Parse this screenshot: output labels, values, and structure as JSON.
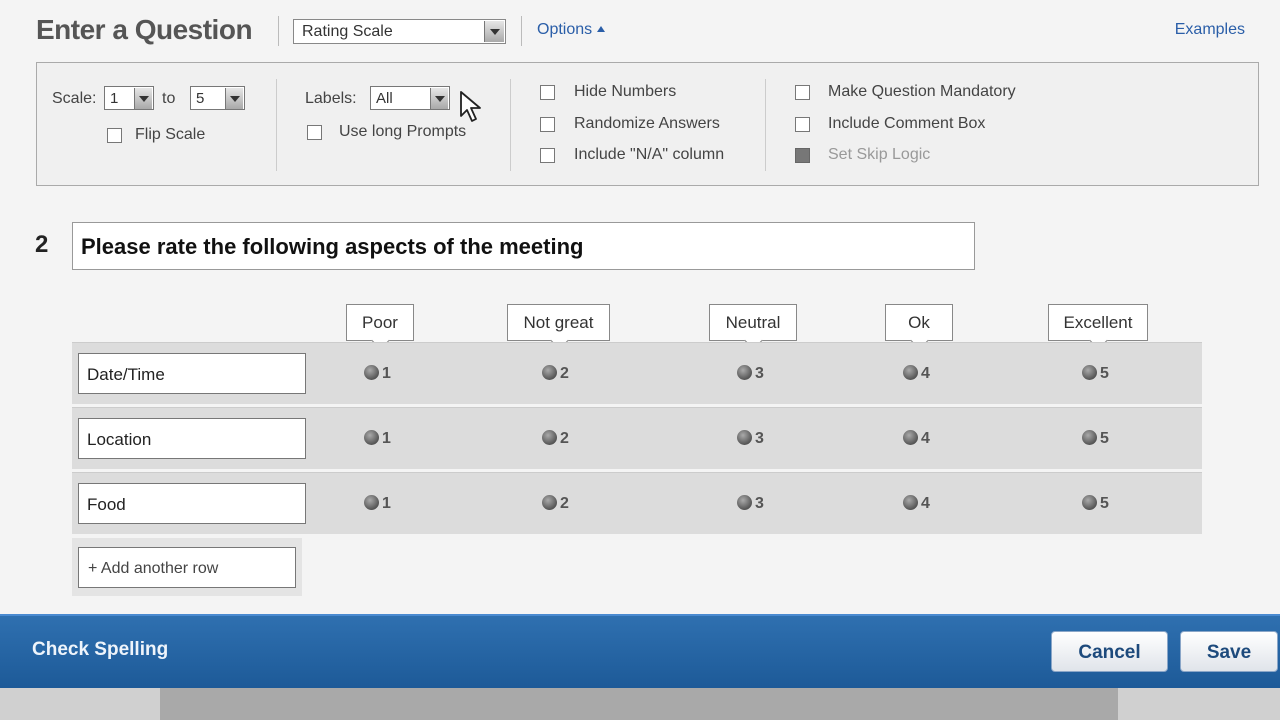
{
  "header": {
    "title": "Enter a Question",
    "question_type": "Rating Scale",
    "options_label": "Options",
    "examples_label": "Examples"
  },
  "options": {
    "scale_label": "Scale:",
    "scale_from": "1",
    "scale_to_label": "to",
    "scale_to": "5",
    "flip_scale": "Flip Scale",
    "labels_label": "Labels:",
    "labels_value": "All",
    "long_prompts": "Use long Prompts",
    "hide_numbers": "Hide Numbers",
    "randomize_answers": "Randomize Answers",
    "include_na": "Include \"N/A\" column",
    "mandatory": "Make Question Mandatory",
    "comment_box": "Include Comment Box",
    "skip_logic": "Set Skip Logic"
  },
  "question": {
    "number": "2",
    "text": "Please rate the following aspects of the meeting"
  },
  "scale_labels": [
    "Poor",
    "Not great",
    "Neutral",
    "Ok",
    "Excellent"
  ],
  "scale_values": [
    "1",
    "2",
    "3",
    "4",
    "5"
  ],
  "rows": [
    "Date/Time",
    "Location",
    "Food"
  ],
  "add_row_label": "+ Add another row",
  "footer": {
    "check_spelling": "Check Spelling",
    "cancel": "Cancel",
    "save": "Save"
  },
  "colors": {
    "footer_blue": "#2468a8",
    "link_blue": "#2a5ea8"
  }
}
